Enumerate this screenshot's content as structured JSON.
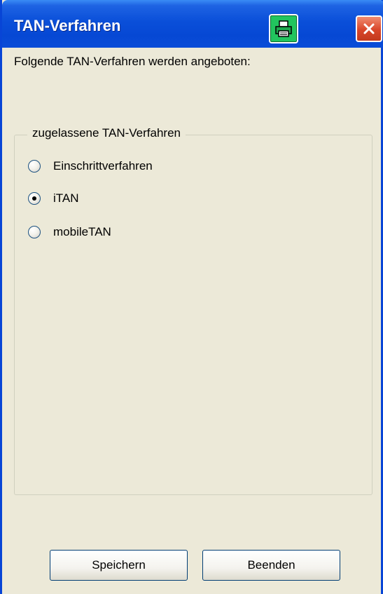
{
  "window": {
    "title": "TAN-Verfahren",
    "print_icon": "printer-icon",
    "close_icon": "close-icon"
  },
  "intro_text": "Folgende TAN-Verfahren werden angeboten:",
  "group": {
    "legend": "zugelassene TAN-Verfahren",
    "options": [
      {
        "label": "Einschrittverfahren",
        "selected": false
      },
      {
        "label": "iTAN",
        "selected": true
      },
      {
        "label": "mobileTAN",
        "selected": false
      }
    ]
  },
  "buttons": {
    "save_label": "Speichern",
    "exit_label": "Beenden"
  },
  "colors": {
    "titlebar": "#0A4FD9",
    "print_button": "#22C55E",
    "close_button": "#D9462A",
    "dialog_background": "#ECE9D8"
  }
}
